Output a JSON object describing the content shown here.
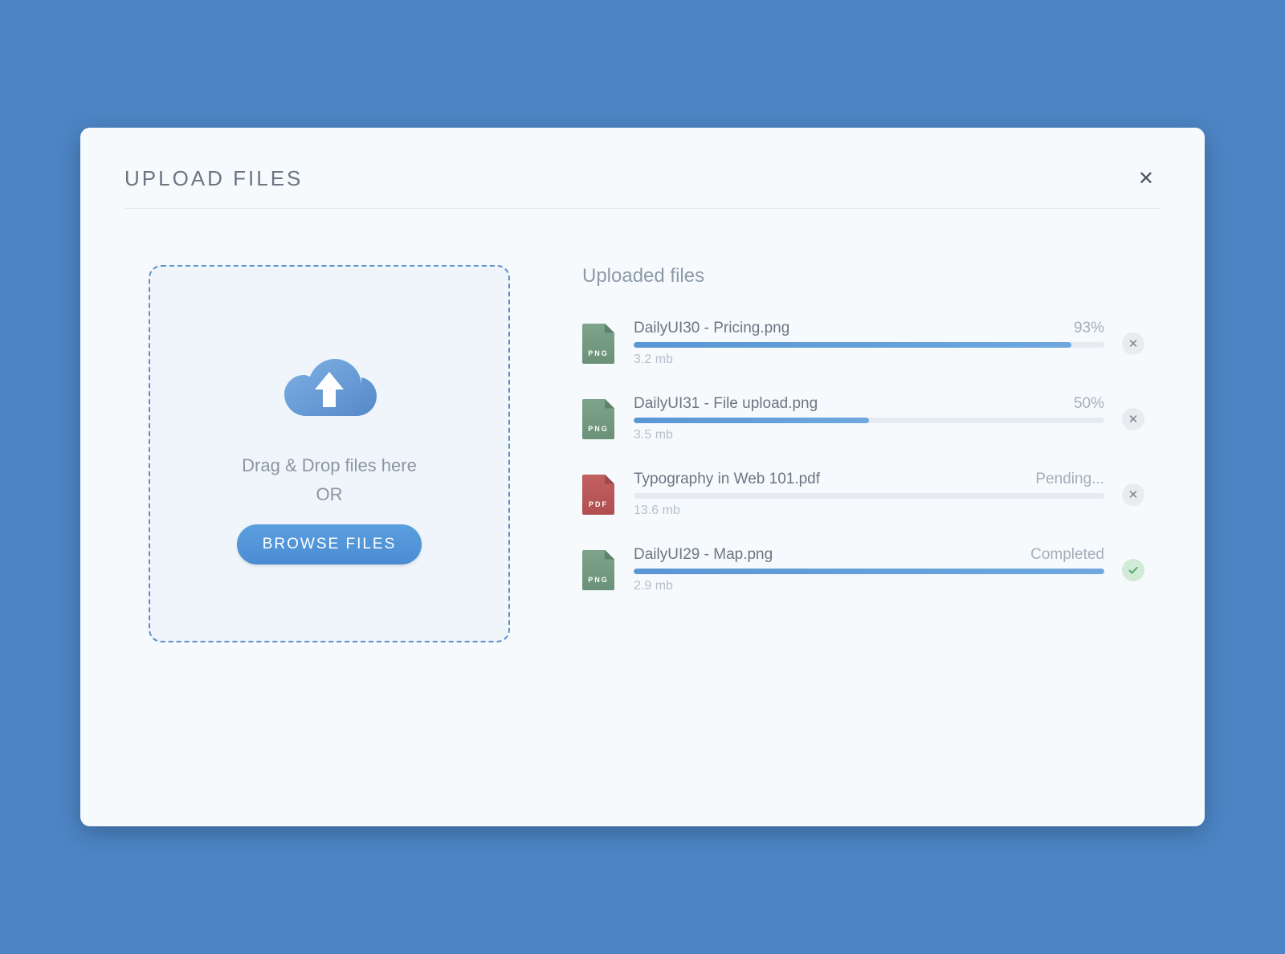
{
  "modal": {
    "title": "UPLOAD FILES"
  },
  "dropzone": {
    "line1": "Drag & Drop files here",
    "line2": "OR",
    "browse_label": "BROWSE FILES"
  },
  "files_section": {
    "title": "Uploaded files"
  },
  "files": [
    {
      "name": "DailyUI30 -  Pricing.png",
      "status": "93%",
      "progress": 93,
      "size": "3.2 mb",
      "type": "PNG",
      "action": "cancel"
    },
    {
      "name": "DailyUI31 -  File upload.png",
      "status": "50%",
      "progress": 50,
      "size": "3.5 mb",
      "type": "PNG",
      "action": "cancel"
    },
    {
      "name": "Typography in Web 101.pdf",
      "status": "Pending...",
      "progress": 0,
      "size": "13.6 mb",
      "type": "PDF",
      "action": "cancel"
    },
    {
      "name": "DailyUI29 -  Map.png",
      "status": "Completed",
      "progress": 100,
      "size": "2.9 mb",
      "type": "PNG",
      "action": "complete"
    }
  ]
}
